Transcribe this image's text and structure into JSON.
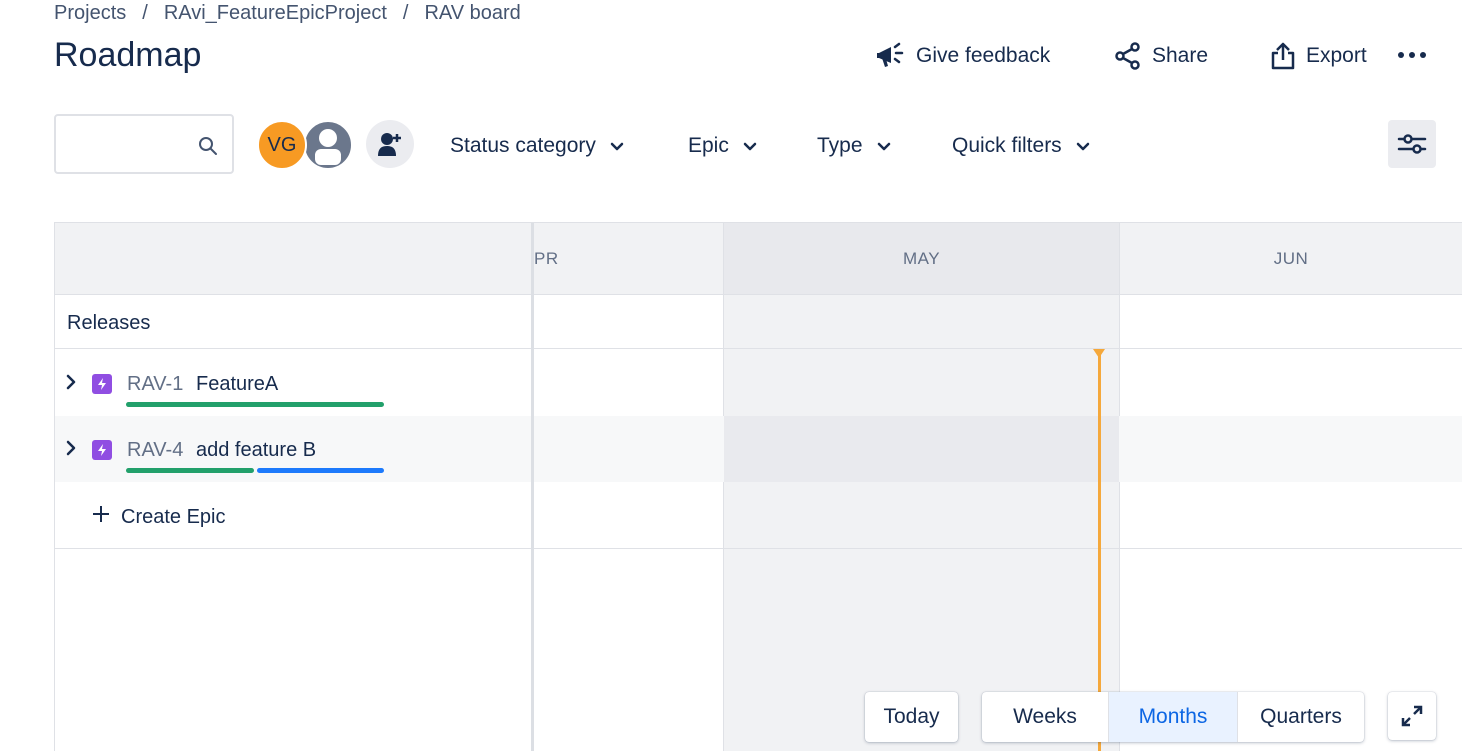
{
  "breadcrumb": {
    "items": [
      "Projects",
      "RAvi_FeatureEpicProject",
      "RAV board"
    ],
    "separator": "/"
  },
  "page": {
    "title": "Roadmap"
  },
  "header_actions": {
    "feedback_label": "Give feedback",
    "share_label": "Share",
    "export_label": "Export"
  },
  "filters": {
    "search_placeholder": "",
    "avatars": [
      {
        "initials": "VG",
        "color": "#f79a23"
      }
    ],
    "dropdowns": [
      "Status category",
      "Epic",
      "Type",
      "Quick filters"
    ]
  },
  "timeline": {
    "months": [
      "PR",
      "MAY",
      "JUN"
    ],
    "releases_label": "Releases",
    "epics": [
      {
        "key": "RAV-1",
        "summary": "FeatureA",
        "progress": {
          "done": 1.0,
          "in_progress": 0.0
        }
      },
      {
        "key": "RAV-4",
        "summary": "add feature B",
        "progress": {
          "done": 0.5,
          "in_progress": 0.5
        }
      }
    ],
    "create_label": "Create Epic"
  },
  "colors": {
    "epic_icon": "#904ee2",
    "progress_done": "#22a06b",
    "progress_in_progress": "#1d7afc",
    "today_marker": "#f5a83b",
    "active_view": "#0c66e4"
  },
  "controls": {
    "today_label": "Today",
    "views": [
      "Weeks",
      "Months",
      "Quarters"
    ],
    "active_view": "Months"
  }
}
